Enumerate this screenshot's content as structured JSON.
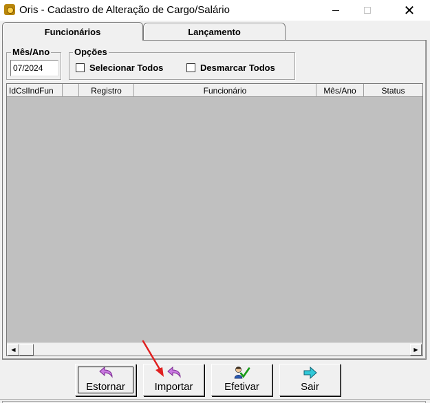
{
  "window": {
    "title": "Oris - Cadastro de Alteração de Cargo/Salário",
    "controls": {
      "minimize_icon": "minimize-icon",
      "maximize_icon": "maximize-icon",
      "close_icon": "close-icon"
    }
  },
  "tabs": [
    {
      "label": "Funcionários",
      "active": true
    },
    {
      "label": "Lançamento",
      "active": false
    }
  ],
  "mes_ano": {
    "legend": "Mês/Ano",
    "value": "07/2024"
  },
  "opcoes": {
    "legend": "Opções",
    "selecionar_todos": "Selecionar Todos",
    "desmarcar_todos": "Desmarcar Todos"
  },
  "grid": {
    "columns": [
      "IdCslIndFun",
      "",
      "Registro",
      "Funcionário",
      "Mês/Ano",
      "Status"
    ],
    "rows": []
  },
  "buttons": {
    "estornar": {
      "label": "Estornar",
      "icon": "undo-arrow-icon",
      "color": "#c060d0"
    },
    "importar": {
      "label": "Importar",
      "icon": "import-arrow-icon",
      "color": "#c060d0"
    },
    "efetivar": {
      "label": "Efetivar",
      "icon": "person-check-icon",
      "color": "#20a020"
    },
    "sair": {
      "label": "Sair",
      "icon": "exit-arrow-icon",
      "color": "#20b0c0"
    }
  },
  "annotation": {
    "icon": "red-pointer-arrow",
    "color": "#e02020"
  }
}
